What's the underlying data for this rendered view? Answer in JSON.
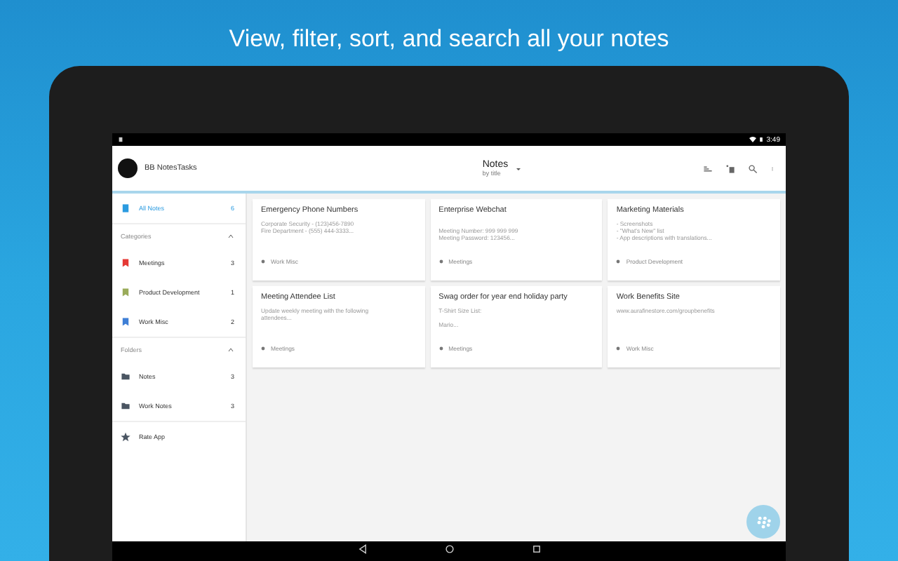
{
  "headline": "View, filter, sort, and search all your notes",
  "status_bar": {
    "time": "3:49"
  },
  "app_bar": {
    "app_name": "BB NotesTasks",
    "title": "Notes",
    "subtitle": "by title"
  },
  "sidebar": {
    "all_notes": {
      "label": "All Notes",
      "count": "6",
      "selected": true
    },
    "sections": [
      {
        "kind": "categories",
        "title": "Categories",
        "expanded": true,
        "items": [
          {
            "label": "Meetings",
            "count": "3",
            "color": "#e53935",
            "selected": false
          },
          {
            "label": "Product Development",
            "count": "1",
            "color": "#9aab5a",
            "selected": false
          },
          {
            "label": "Work Misc",
            "count": "2",
            "color": "#3f7fd6",
            "selected": false
          }
        ]
      },
      {
        "kind": "folders",
        "title": "Folders",
        "expanded": true,
        "items": [
          {
            "label": "Notes",
            "count": "3",
            "selected": false
          },
          {
            "label": "Work Notes",
            "count": "3",
            "selected": false
          }
        ]
      }
    ],
    "rate": {
      "label": "Rate App"
    }
  },
  "notes": [
    {
      "title": "Emergency Phone Numbers",
      "lines": [
        {
          "text": "Corporate Security - (123)456-7890"
        },
        {
          "text": "Fire Department - (555) 444-3333..."
        }
      ],
      "tag": "Work Misc"
    },
    {
      "title": "Enterprise Webchat",
      "lines": [
        {
          "text": "Meeting Number: 999 999 999",
          "blank_before": true
        },
        {
          "text": "Meeting Password: 123456..."
        }
      ],
      "tag": "Meetings"
    },
    {
      "title": "Marketing Materials",
      "lines": [
        {
          "text": "- Screenshots"
        },
        {
          "text": "- \"What's New\" list"
        },
        {
          "text": "- App descriptions with translations..."
        }
      ],
      "tag": "Product Development"
    },
    {
      "title": "Meeting Attendee List",
      "lines": [
        {
          "text": "Update weekly meeting with the following"
        },
        {
          "text": "attendees..."
        }
      ],
      "tag": "Meetings"
    },
    {
      "title": "Swag order for year end holiday party",
      "lines": [
        {
          "text": "T-Shirt Size List:"
        },
        {
          "text": "Mario...",
          "blank_before": true
        }
      ],
      "tag": "Meetings"
    },
    {
      "title": "Work Benefits Site",
      "lines": [
        {
          "text": "www.aurafinestore.com/groupbenefits"
        }
      ],
      "tag": "Work Misc"
    }
  ]
}
